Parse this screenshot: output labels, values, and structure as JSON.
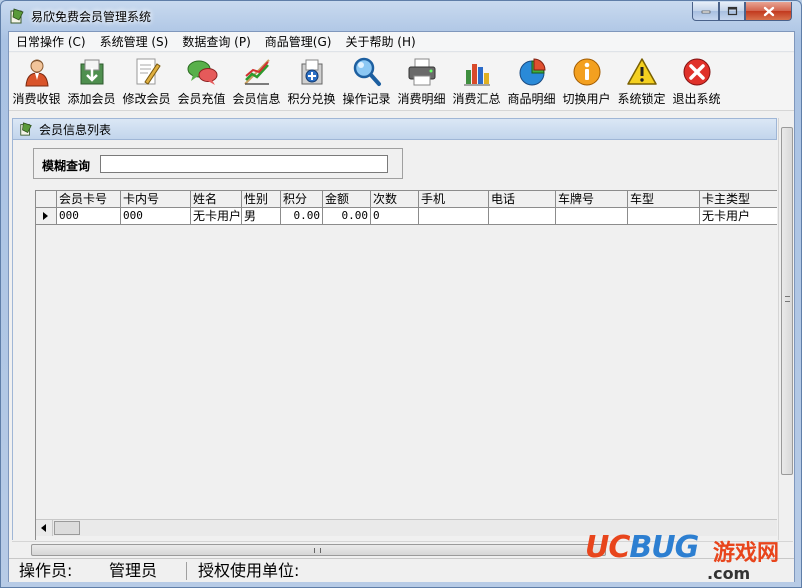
{
  "window": {
    "title": "易欣免费会员管理系统",
    "buttons": {
      "minimize": "minimize",
      "maximize": "maximize",
      "close": "close"
    }
  },
  "menu": [
    {
      "label": "日常操作 (C)"
    },
    {
      "label": "系统管理 (S)"
    },
    {
      "label": "数据查询 (P)"
    },
    {
      "label": "商品管理(G)"
    },
    {
      "label": "关于帮助 (H)"
    }
  ],
  "toolbar": [
    {
      "label": "消费收银",
      "icon": "cashier-person-icon"
    },
    {
      "label": "添加会员",
      "icon": "add-member-icon"
    },
    {
      "label": "修改会员",
      "icon": "edit-member-icon"
    },
    {
      "label": "会员充值",
      "icon": "recharge-chat-icon"
    },
    {
      "label": "会员信息",
      "icon": "member-info-chart-icon"
    },
    {
      "label": "积分兑换",
      "icon": "points-exchange-icon"
    },
    {
      "label": "操作记录",
      "icon": "search-magnifier-icon"
    },
    {
      "label": "消费明细",
      "icon": "printer-icon"
    },
    {
      "label": "消费汇总",
      "icon": "bar-chart-icon"
    },
    {
      "label": "商品明细",
      "icon": "pie-chart-icon"
    },
    {
      "label": "切换用户",
      "icon": "info-switch-user-icon"
    },
    {
      "label": "系统锁定",
      "icon": "warning-lock-icon"
    },
    {
      "label": "退出系统",
      "icon": "exit-close-icon"
    }
  ],
  "panel": {
    "title": "会员信息列表"
  },
  "search": {
    "label": "模糊查询",
    "value": "",
    "placeholder": ""
  },
  "grid": {
    "columns": [
      "会员卡号",
      "卡内号",
      "姓名",
      "性别",
      "积分",
      "金额",
      "次数",
      "手机",
      "电话",
      "车牌号",
      "车型",
      "卡主类型"
    ],
    "rows": [
      [
        "000",
        "000",
        "无卡用户",
        "男",
        "0.00",
        "0.00",
        "0",
        "",
        "",
        "",
        "",
        "无卡用户"
      ]
    ]
  },
  "statusbar": {
    "operator_label": "操作员:",
    "operator": "管理员",
    "license_label": "授权使用单位:"
  },
  "watermark": {
    "brand_a": "UC",
    "brand_b": "BUG",
    "brand_cn": "游戏网",
    "domain": ".com"
  },
  "colors": {
    "title_gradient_top": "#c9daef",
    "panel_header": "#c2d5ec",
    "watermark_red": "#e8451c",
    "watermark_blue": "#2d7fd1"
  }
}
